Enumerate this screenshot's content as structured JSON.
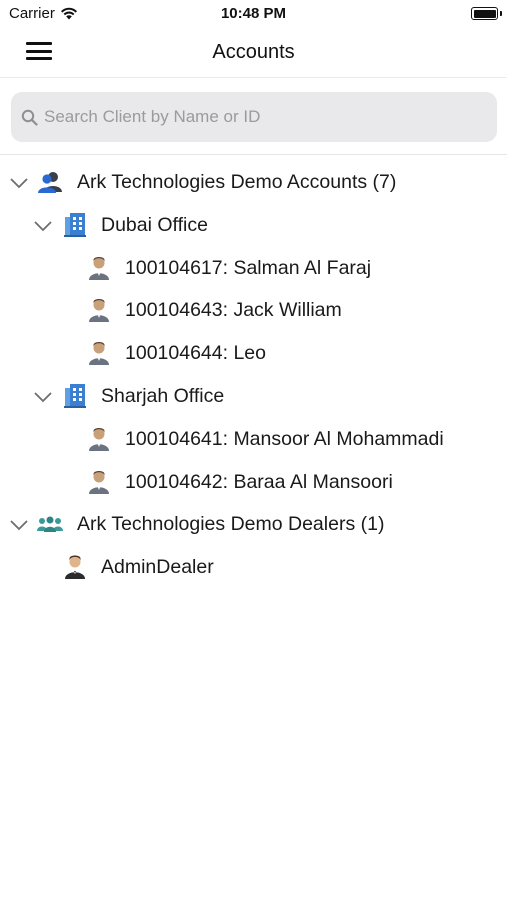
{
  "status": {
    "carrier": "Carrier",
    "time": "10:48 PM"
  },
  "nav": {
    "title": "Accounts"
  },
  "search": {
    "placeholder": "Search Client by Name or ID",
    "value": ""
  },
  "tree": {
    "accounts_group": {
      "label": "Ark Technologies Demo Accounts (7)",
      "expanded": true,
      "icon": "users-group-icon",
      "offices": [
        {
          "label": "Dubai Office",
          "expanded": true,
          "icon": "building-icon",
          "clients": [
            {
              "label": "100104617: Salman Al Faraj",
              "icon": "user-icon"
            },
            {
              "label": "100104643: Jack William",
              "icon": "user-icon"
            },
            {
              "label": "100104644: Leo",
              "icon": "user-icon"
            }
          ]
        },
        {
          "label": "Sharjah Office",
          "expanded": true,
          "icon": "building-icon",
          "clients": [
            {
              "label": "100104641: Mansoor Al Mohammadi",
              "icon": "user-icon"
            },
            {
              "label": "100104642: Baraa Al Mansoori",
              "icon": "user-icon"
            }
          ]
        }
      ]
    },
    "dealers_group": {
      "label": "Ark Technologies Demo Dealers (1)",
      "expanded": true,
      "icon": "team-icon",
      "dealers": [
        {
          "label": "AdminDealer",
          "icon": "dealer-icon"
        }
      ]
    }
  },
  "colors": {
    "chevron": "#6d6d72",
    "building_blue": "#3a7fd0",
    "user_blue": "#1f5fb0",
    "team_teal": "#3a9a9a",
    "search_bg": "#e9e9eb"
  }
}
